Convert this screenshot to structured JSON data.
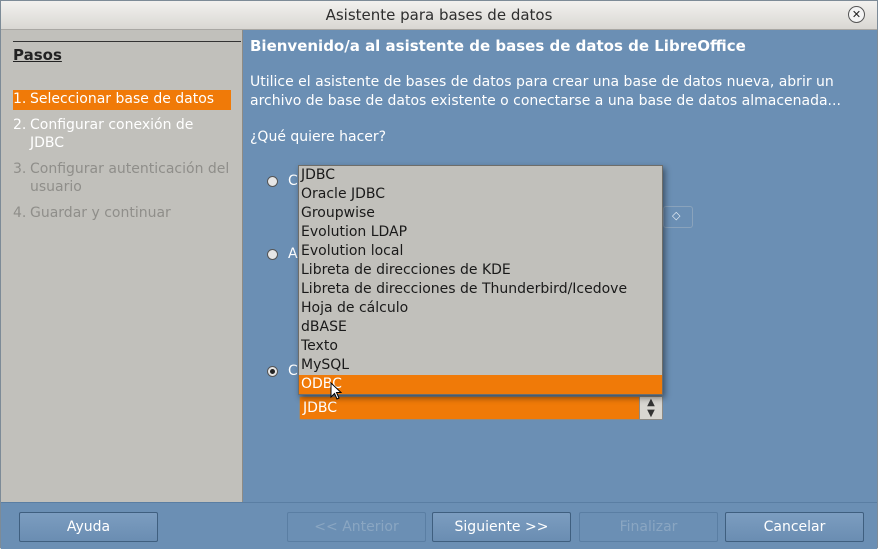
{
  "window": {
    "title": "Asistente para bases de datos"
  },
  "steps": {
    "title": "Pasos",
    "items": [
      {
        "num": "1.",
        "label": "Seleccionar base de datos",
        "state": "active"
      },
      {
        "num": "2.",
        "label": "Configurar conexión de JDBC",
        "state": "enabled"
      },
      {
        "num": "3.",
        "label": "Configurar autenticación del usuario",
        "state": "disabled"
      },
      {
        "num": "4.",
        "label": "Guardar y continuar",
        "state": "disabled"
      }
    ]
  },
  "main": {
    "heading": "Bienvenido/a al asistente de bases de datos de LibreOffice",
    "intro_line1": "Utilice el asistente de bases de datos para crear una base de datos nueva, abrir un",
    "intro_line2": "archivo de base de datos existente o conectarse a una base de datos almacenada...",
    "question": "¿Qué quiere hacer?",
    "radio_letters": [
      "C",
      "A",
      "C"
    ],
    "combo_value": "JDBC"
  },
  "dropdown": {
    "options": [
      "JDBC",
      "Oracle JDBC",
      "Groupwise",
      "Evolution LDAP",
      "Evolution local",
      "Libreta de direcciones de KDE",
      "Libreta de direcciones de Thunderbird/Icedove",
      "Hoja de cálculo",
      "dBASE",
      "Texto",
      "MySQL",
      "ODBC"
    ],
    "selected": "ODBC"
  },
  "footer": {
    "help": "Ayuda",
    "back": "<< Anterior",
    "next": "Siguiente >>",
    "finish": "Finalizar",
    "cancel": "Cancelar"
  },
  "colors": {
    "accent": "#f07a08",
    "panel": "#6b8fb4",
    "sidebar": "#c1c0bb"
  }
}
